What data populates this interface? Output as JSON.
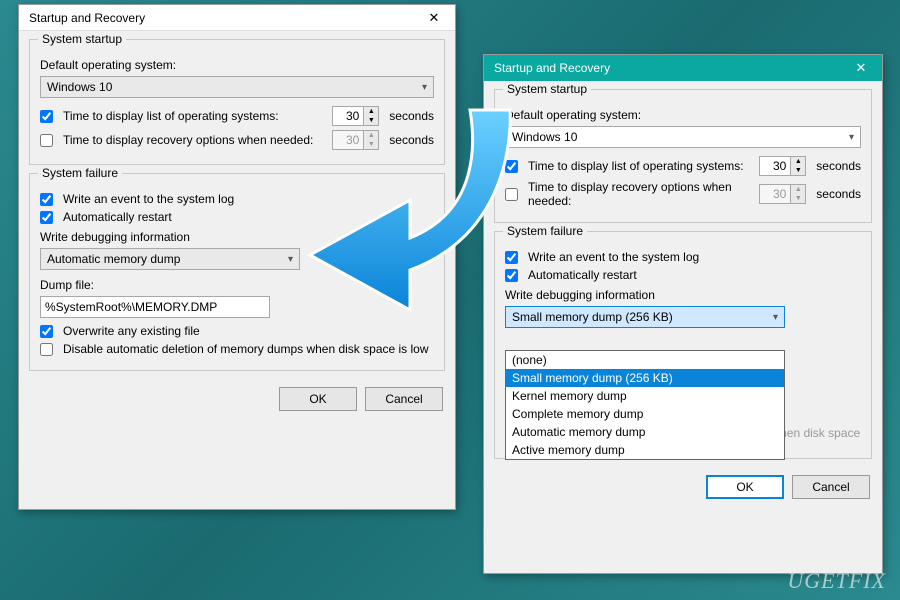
{
  "dialogLeft": {
    "title": "Startup and Recovery",
    "startup": {
      "legend": "System startup",
      "defaultOsLabel": "Default operating system:",
      "defaultOs": "Windows 10",
      "timeListLabel": "Time to display list of operating systems:",
      "timeListValue": "30",
      "timeRecoveryLabel": "Time to display recovery options when needed:",
      "timeRecoveryValue": "30",
      "secondsLabel": "seconds"
    },
    "failure": {
      "legend": "System failure",
      "writeEvent": "Write an event to the system log",
      "autoRestart": "Automatically restart",
      "writeDebugLabel": "Write debugging information",
      "debugSelected": "Automatic memory dump",
      "dumpFileLabel": "Dump file:",
      "dumpFileValue": "%SystemRoot%\\MEMORY.DMP",
      "overwrite": "Overwrite any existing file",
      "disableDelete": "Disable automatic deletion of memory dumps when disk space is low"
    },
    "buttons": {
      "ok": "OK",
      "cancel": "Cancel"
    }
  },
  "dialogRight": {
    "title": "Startup and Recovery",
    "startup": {
      "legend": "System startup",
      "defaultOsLabel": "Default operating system:",
      "defaultOs": "Windows 10",
      "timeListLabel": "Time to display list of operating systems:",
      "timeListValue": "30",
      "timeRecoveryLabel": "Time to display recovery options when needed:",
      "timeRecoveryValue": "30",
      "secondsLabel": "seconds"
    },
    "failure": {
      "legend": "System failure",
      "writeEvent": "Write an event to the system log",
      "autoRestart": "Automatically restart",
      "writeDebugLabel": "Write debugging information",
      "debugSelected": "Small memory dump (256 KB)",
      "options": [
        "(none)",
        "Small memory dump (256 KB)",
        "Kernel memory dump",
        "Complete memory dump",
        "Automatic memory dump",
        "Active memory dump"
      ],
      "disableDelete": "Disable automatic deletion of memory dumps when disk space is low"
    },
    "buttons": {
      "ok": "OK",
      "cancel": "Cancel"
    }
  },
  "watermark": "UGETFIX"
}
